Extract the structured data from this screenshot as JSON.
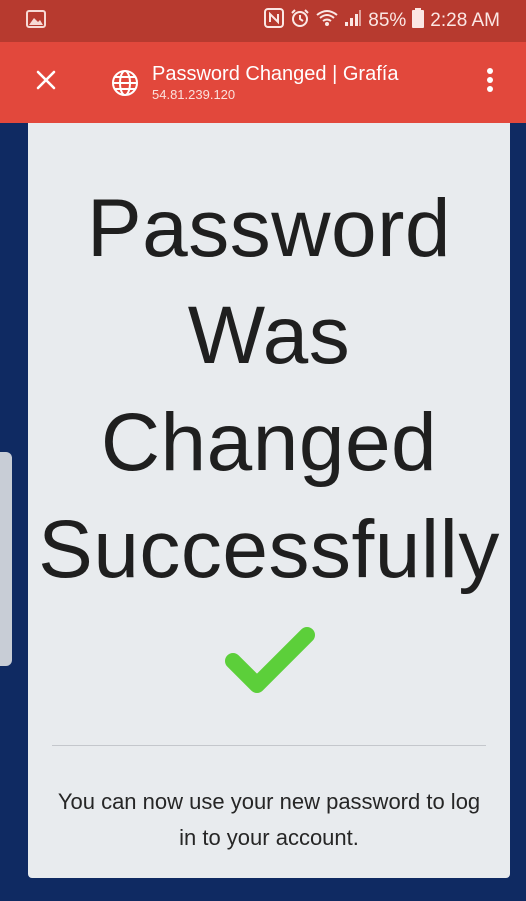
{
  "status_bar": {
    "battery": "85%",
    "time": "2:28 AM",
    "icons": [
      "gallery-icon",
      "nfc-icon",
      "alarm-icon",
      "wifi-icon",
      "signal-icon",
      "battery-icon"
    ]
  },
  "toolbar": {
    "title": "Password Changed | Grafía",
    "url": "54.81.239.120",
    "close_icon": "close-icon",
    "site_icon": "globe-icon",
    "menu_icon": "more-vert-icon"
  },
  "main": {
    "heading_lines": [
      "Password",
      "Was",
      "Changed",
      "Successfully"
    ],
    "check_icon": "checkmark-icon",
    "message": "You can now use your new password to log in to your account."
  },
  "colors": {
    "status_bar": "#b73a2f",
    "toolbar": "#e2483c",
    "page_background": "#0f2a62",
    "card": "#e8ebee",
    "checkmark": "#5ccf3a"
  }
}
